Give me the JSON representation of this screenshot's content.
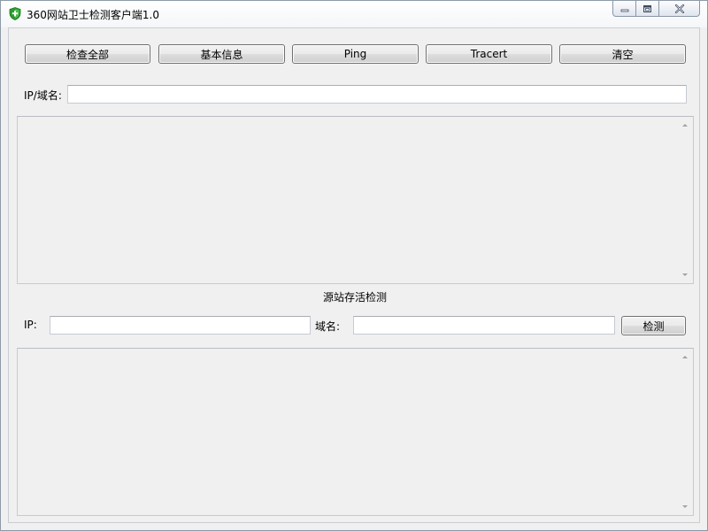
{
  "window": {
    "title": "360网站卫士检测客户端1.0"
  },
  "toolbar": {
    "buttons": [
      {
        "label": "检查全部"
      },
      {
        "label": "基本信息"
      },
      {
        "label": "Ping"
      },
      {
        "label": "Tracert"
      },
      {
        "label": "清空"
      }
    ]
  },
  "target": {
    "label": "IP/域名:",
    "value": "",
    "placeholder": ""
  },
  "output_top": {
    "text": ""
  },
  "origin_check": {
    "section_title": "源站存活检测",
    "ip_label": "IP:",
    "ip_value": "",
    "domain_label": "域名:",
    "domain_value": "",
    "check_button": "检测"
  },
  "output_bottom": {
    "text": ""
  },
  "colors": {
    "window_bg": "#f0f0f0",
    "icon_green": "#2a9d2a",
    "border": "#c5cbd3"
  },
  "icons": {
    "app": "shield-icon",
    "minimize": "minimize-icon",
    "maximize": "maximize-icon",
    "close": "close-icon"
  }
}
